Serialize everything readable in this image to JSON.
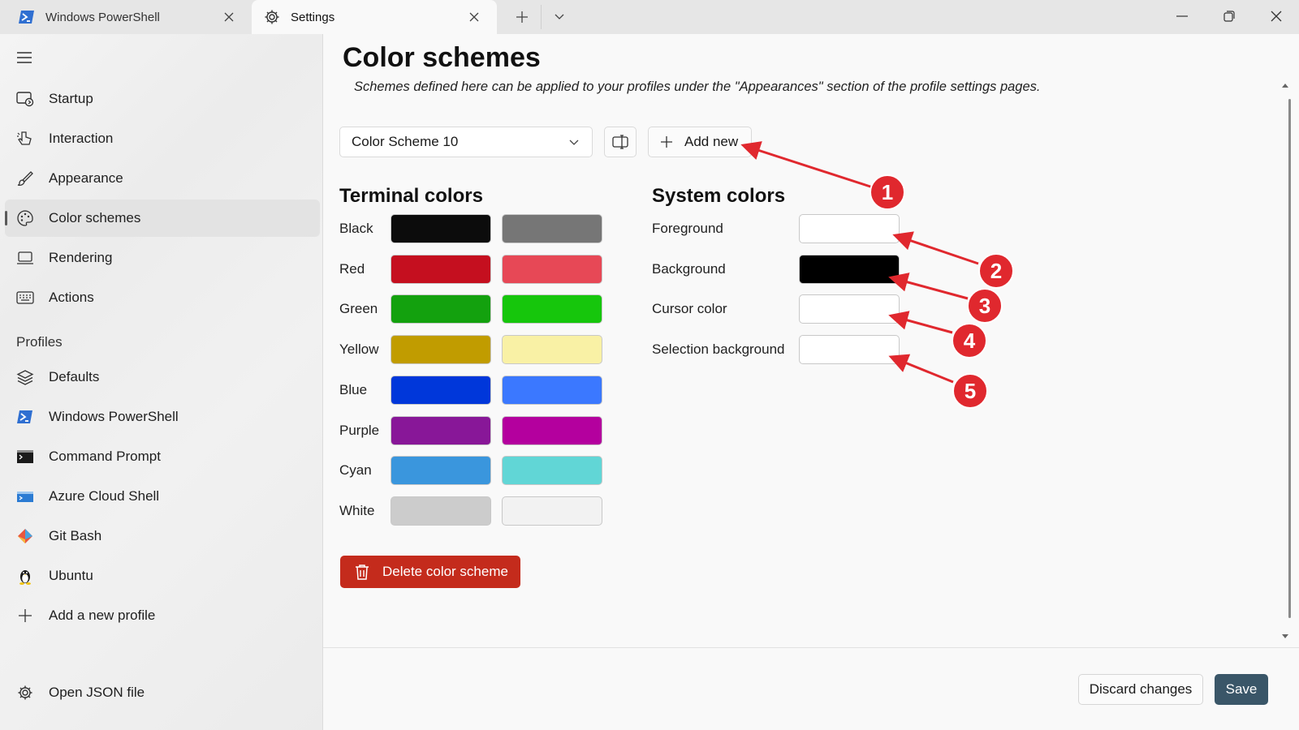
{
  "tabs": [
    {
      "label": "Windows PowerShell",
      "icon": "powershell-icon"
    },
    {
      "label": "Settings",
      "icon": "gear-icon"
    }
  ],
  "sidebar": {
    "items": [
      {
        "label": "Startup",
        "icon": "startup-icon"
      },
      {
        "label": "Interaction",
        "icon": "interaction-icon"
      },
      {
        "label": "Appearance",
        "icon": "brush-icon"
      },
      {
        "label": "Color schemes",
        "icon": "palette-icon",
        "active": true
      },
      {
        "label": "Rendering",
        "icon": "monitor-icon"
      },
      {
        "label": "Actions",
        "icon": "keyboard-icon"
      }
    ],
    "section_label": "Profiles",
    "profiles": [
      {
        "label": "Defaults",
        "icon": "layers-icon"
      },
      {
        "label": "Windows PowerShell",
        "icon": "powershell-icon"
      },
      {
        "label": "Command Prompt",
        "icon": "cmd-icon"
      },
      {
        "label": "Azure Cloud Shell",
        "icon": "azure-icon"
      },
      {
        "label": "Git Bash",
        "icon": "git-icon"
      },
      {
        "label": "Ubuntu",
        "icon": "tux-icon"
      },
      {
        "label": "Add a new profile",
        "icon": "plus-icon"
      }
    ],
    "footer": {
      "label": "Open JSON file",
      "icon": "gear-icon"
    }
  },
  "main": {
    "title": "Color schemes",
    "subtitle": "Schemes defined here can be applied to your profiles under the \"Appearances\" section of the profile settings pages.",
    "selected_scheme": "Color Scheme 10",
    "add_new_label": "Add new",
    "terminal_colors": {
      "title": "Terminal colors",
      "rows": [
        {
          "label": "Black",
          "normal": "#0c0c0c",
          "bright": "#767676"
        },
        {
          "label": "Red",
          "normal": "#c50f1f",
          "bright": "#e74856"
        },
        {
          "label": "Green",
          "normal": "#13a10e",
          "bright": "#16c60c"
        },
        {
          "label": "Yellow",
          "normal": "#c19c00",
          "bright": "#f9f1a5"
        },
        {
          "label": "Blue",
          "normal": "#0037da",
          "bright": "#3b78ff"
        },
        {
          "label": "Purple",
          "normal": "#881798",
          "bright": "#b4009e"
        },
        {
          "label": "Cyan",
          "normal": "#3a96dd",
          "bright": "#61d6d6"
        },
        {
          "label": "White",
          "normal": "#cccccc",
          "bright": "#f2f2f2"
        }
      ]
    },
    "system_colors": {
      "title": "System colors",
      "rows": [
        {
          "label": "Foreground",
          "color": "#ffffff"
        },
        {
          "label": "Background",
          "color": "#000000"
        },
        {
          "label": "Cursor color",
          "color": "#ffffff"
        },
        {
          "label": "Selection background",
          "color": "#ffffff"
        }
      ]
    },
    "delete_label": "Delete color scheme",
    "discard_label": "Discard changes",
    "save_label": "Save"
  },
  "annotations": {
    "color": "#e0282e",
    "badges": [
      "1",
      "2",
      "3",
      "4",
      "5"
    ]
  }
}
